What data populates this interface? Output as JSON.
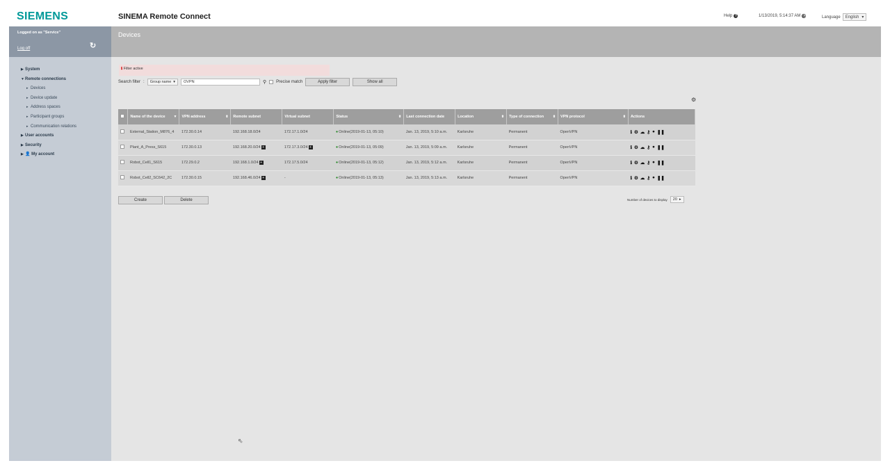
{
  "header": {
    "logo": "SIEMENS",
    "app_title": "SINEMA Remote Connect",
    "help_label": "Help",
    "datetime": "1/13/2019, 5:14:37 AM",
    "language_label": "Language",
    "language_value": "English"
  },
  "sidebar": {
    "logged_on": "Logged on as \"Service\"",
    "logoff": "Log off",
    "items": [
      {
        "label": "System",
        "level": "top",
        "expanded": false
      },
      {
        "label": "Remote connections",
        "level": "top",
        "expanded": true
      },
      {
        "label": "Devices",
        "level": "sub"
      },
      {
        "label": "Device update",
        "level": "sub"
      },
      {
        "label": "Address spaces",
        "level": "sub"
      },
      {
        "label": "Participant groups",
        "level": "sub"
      },
      {
        "label": "Communication relations",
        "level": "sub"
      },
      {
        "label": "User accounts",
        "level": "top",
        "expanded": false
      },
      {
        "label": "Security",
        "level": "top",
        "expanded": false
      },
      {
        "label": "My account",
        "level": "top",
        "expanded": false
      }
    ]
  },
  "main": {
    "title": "Devices",
    "filter_active": "Filter active",
    "search_filter_label": "Search filter",
    "filter_field": "Group name",
    "filter_value": "OVPN",
    "precise_match_label": "Precise match",
    "apply_filter": "Apply filter",
    "show_all": "Show all",
    "columns": [
      "Name of the device",
      "VPN address",
      "Remote subnet",
      "Virtual subnet",
      "Status",
      "Last connection date",
      "Location",
      "Type of connection",
      "VPN protocol",
      "Actions"
    ],
    "rows": [
      {
        "name": "External_Station_M876_4",
        "vpn": "172.30.0.14",
        "remote": "192.168.18.0/24",
        "remote_more": false,
        "virtual": "172.17.1.0/24",
        "virtual_more": false,
        "status": "Online(2019-01-13, 05:10)",
        "last": "Jan. 13, 2019, 5:10 a.m.",
        "location": "Karlsruhe",
        "type": "Permanent",
        "protocol": "OpenVPN"
      },
      {
        "name": "Plant_A_Press_S615",
        "vpn": "172.30.0.13",
        "remote": "192.168.20.0/24",
        "remote_more": true,
        "virtual": "172.17.3.0/24",
        "virtual_more": true,
        "status": "Online(2019-01-13, 05:09)",
        "last": "Jan. 13, 2019, 5:09 a.m.",
        "location": "Karlsruhe",
        "type": "Permanent",
        "protocol": "OpenVPN"
      },
      {
        "name": "Robot_Cell1_S615",
        "vpn": "172.29.0.2",
        "remote": "192.168.1.0/24",
        "remote_more": true,
        "virtual": "172.17.5.0/24",
        "virtual_more": false,
        "status": "Online(2019-01-13, 05:12)",
        "last": "Jan. 13, 2019, 5:12 a.m.",
        "location": "Karlsruhe",
        "type": "Permanent",
        "protocol": "OpenVPN"
      },
      {
        "name": "Robot_Cell2_SC642_2C",
        "vpn": "172.30.0.15",
        "remote": "192.168.46.0/24",
        "remote_more": true,
        "virtual": "-",
        "virtual_more": false,
        "status": "Online(2019-01-13, 05:13)",
        "last": "Jan. 13, 2019, 5:13 a.m.",
        "location": "Karlsruhe",
        "type": "Permanent",
        "protocol": "OpenVPN"
      }
    ],
    "create": "Create",
    "delete": "Delete",
    "per_page_label": "Number of devices to display",
    "per_page_value": "20"
  },
  "colors": {
    "brand": "#009999",
    "sidebar_bg": "#c5ccd5",
    "sidebar_head": "#8c97a5",
    "main_bg": "#e5e5e5",
    "main_head": "#b4b4b4",
    "table_header": "#9e9e9e",
    "filter_active_bg": "#f2dcdc",
    "online": "#2a8a2a"
  }
}
